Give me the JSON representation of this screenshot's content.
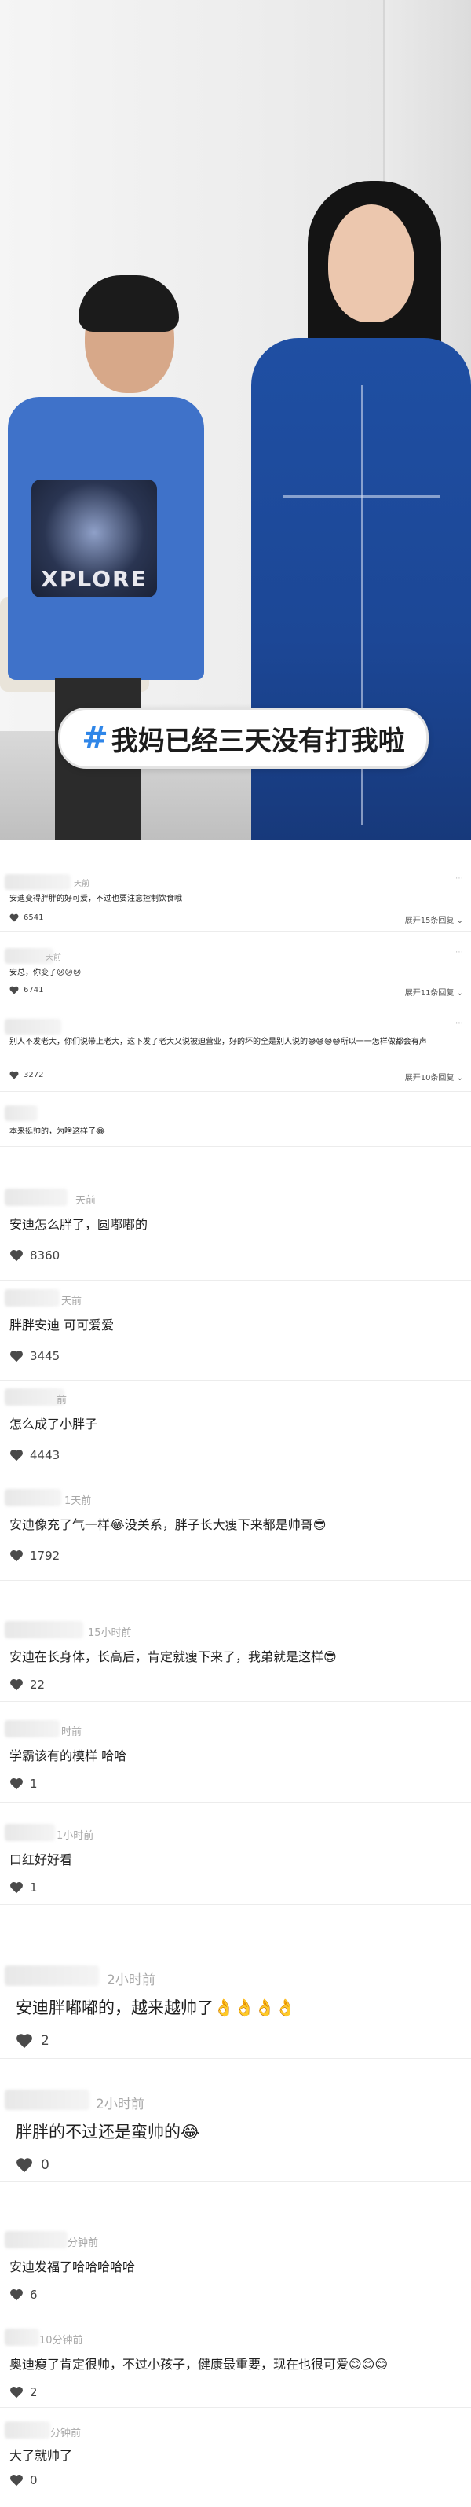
{
  "video": {
    "caption_hash": "#",
    "caption_text": "我妈已经三天没有打我啦",
    "shirt_print": "XPLORE"
  },
  "comments": [
    {
      "time": "天前",
      "text": "安迪变得胖胖的好可爱，不过也要注意控制饮食哦",
      "likes": "6541",
      "expand": "展开15条回复"
    },
    {
      "time": "天前",
      "text": "安总，你变了😕😕😕",
      "likes": "6741",
      "expand": "展开11条回复"
    },
    {
      "time": "",
      "text": "别人不发老大，你们说带上老大，这下发了老大又说被迫营业，好的坏的全是别人说的😅😅😅😅所以一一怎样做都会有声",
      "likes": "3272",
      "expand": "展开10条回复"
    },
    {
      "time": "",
      "text": "本来挺帅的，为啥这样了😂",
      "likes": "",
      "expand": ""
    },
    {
      "time": "天前",
      "text": "安迪怎么胖了，圆嘟嘟的",
      "likes": "8360",
      "expand": ""
    },
    {
      "time": "天前",
      "text": "胖胖安迪 可可爱爱",
      "likes": "3445",
      "expand": ""
    },
    {
      "time": "前",
      "text": "怎么成了小胖子",
      "likes": "4443",
      "expand": ""
    },
    {
      "time": "1天前",
      "text": "安迪像充了气一样😂没关系，胖子长大瘦下来都是帅哥😎",
      "likes": "1792",
      "expand": ""
    },
    {
      "time": "15小时前",
      "text": "安迪在长身体，长高后，肯定就瘦下来了，我弟就是这样😎",
      "likes": "22",
      "expand": ""
    },
    {
      "time": "时前",
      "text": "学霸该有的模样 哈哈",
      "likes": "1",
      "expand": ""
    },
    {
      "time": "1小时前",
      "text": "口红好好看",
      "likes": "1",
      "expand": ""
    },
    {
      "time": "2小时前",
      "text": "安迪胖嘟嘟的，越来越帅了👌👌👌👌",
      "likes": "2",
      "expand": ""
    },
    {
      "time": "2小时前",
      "text": "胖胖的不过还是蛮帅的😂",
      "likes": "0",
      "expand": ""
    },
    {
      "time": "分钟前",
      "text": "安迪发福了哈哈哈哈哈",
      "likes": "6",
      "expand": ""
    },
    {
      "time": "10分钟前",
      "text": "奥迪瘦了肯定很帅，不过小孩子，健康最重要，现在也很可爱😊😊😊",
      "likes": "2",
      "expand": ""
    },
    {
      "time": "分钟前",
      "text": "大了就帅了",
      "likes": "0",
      "expand": ""
    }
  ]
}
